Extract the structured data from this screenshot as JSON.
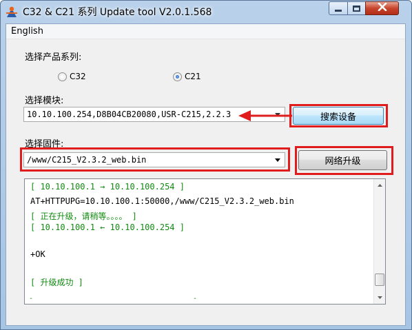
{
  "window": {
    "title": "C32 & C21 系列 Update tool V2.0.1.568",
    "icon": "app-logo-icon",
    "buttons": [
      "minimize-icon",
      "maximize-icon",
      "close-icon"
    ]
  },
  "menu": {
    "items": [
      "English"
    ]
  },
  "product": {
    "label": "选择产品系列:",
    "options": [
      {
        "label": "C32",
        "selected": false
      },
      {
        "label": "C21",
        "selected": true
      }
    ]
  },
  "module": {
    "label": "选择模块:",
    "value": "10.10.100.254,D8B04CB20080,USR-C215,2.2.3",
    "search_button": "搜索设备"
  },
  "firmware": {
    "label": "选择固件:",
    "value": "/www/C215_V2.3.2_web.bin",
    "upgrade_button": "网络升级"
  },
  "log": {
    "lines": [
      {
        "text": "[ 10.10.100.1 → 10.10.100.254 ]",
        "color": "green"
      },
      {
        "text": "AT+HTTPUPG=10.10.100.1:50000,/www/C215_V2.3.2_web.bin",
        "color": "black"
      },
      {
        "text": "[ 正在升级，请稍等。。。。 ]",
        "color": "green"
      },
      {
        "text": "[ 10.10.100.1 ← 10.10.100.254 ]",
        "color": "green"
      },
      {
        "text": "",
        "color": "black"
      },
      {
        "text": "+OK",
        "color": "black"
      },
      {
        "text": "",
        "color": "black"
      },
      {
        "text": "[ 升级成功 ]",
        "color": "green"
      }
    ]
  },
  "colors": {
    "annotation": "#e01c1c",
    "log_green": "#108a10",
    "title_bar": "#b9d1ea"
  }
}
